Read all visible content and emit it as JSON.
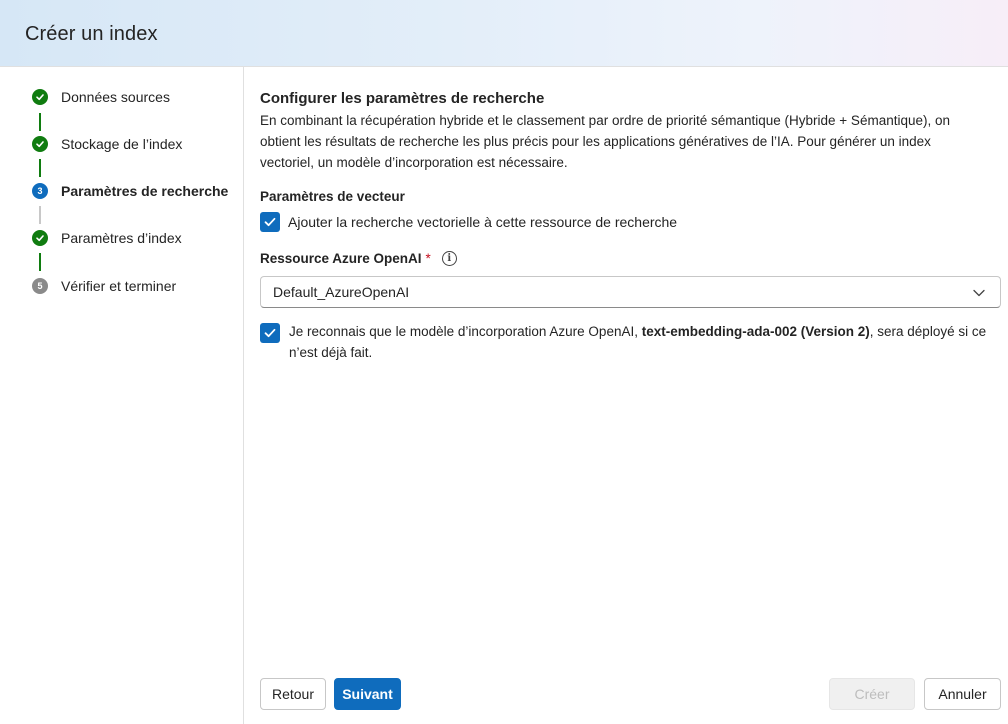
{
  "header": {
    "title": "Créer un index"
  },
  "steps": [
    {
      "label": "Données sources",
      "status": "done",
      "number": ""
    },
    {
      "label": "Stockage de l’index",
      "status": "done",
      "number": ""
    },
    {
      "label": "Paramètres de recherche",
      "status": "current",
      "number": "3"
    },
    {
      "label": "Paramètres d’index",
      "status": "done",
      "number": ""
    },
    {
      "label": "Vérifier et terminer",
      "status": "pending",
      "number": "5"
    }
  ],
  "main": {
    "title": "Configurer les paramètres de recherche",
    "description": "En combinant la récupération hybride et le classement par ordre de priorité sémantique (Hybride + Sémantique), on obtient les résultats de recherche les plus précis pour les applications génératives de l’IA. Pour générer un index vectoriel, un modèle d’incorporation est nécessaire.",
    "vector_section_title": "Paramètres de vecteur",
    "vector_checkbox": {
      "label": "Ajouter la recherche vectorielle à cette ressource de recherche",
      "checked": true
    },
    "openai_field": {
      "label": "Ressource Azure OpenAI",
      "required_mark": "*",
      "value": "Default_AzureOpenAI"
    },
    "ack_checkbox": {
      "checked": true,
      "text_before": "Je reconnais que le modèle d’incorporation Azure OpenAI, ",
      "text_bold": "text-embedding-ada-002 (Version 2)",
      "text_after": ", sera déployé si ce n’est déjà fait."
    }
  },
  "footer": {
    "back_label": "Retour",
    "next_label": "Suivant",
    "create_label": "Créer",
    "cancel_label": "Annuler"
  },
  "colors": {
    "accent": "#0f6cbd",
    "success": "#107c10",
    "pending": "#8a8a8a",
    "required": "#c50f1f"
  },
  "icons": {
    "step_done": "checkmark-circle-icon",
    "info": "info-icon",
    "dropdown": "chevron-down-icon",
    "checkbox": "checkmark-icon"
  }
}
